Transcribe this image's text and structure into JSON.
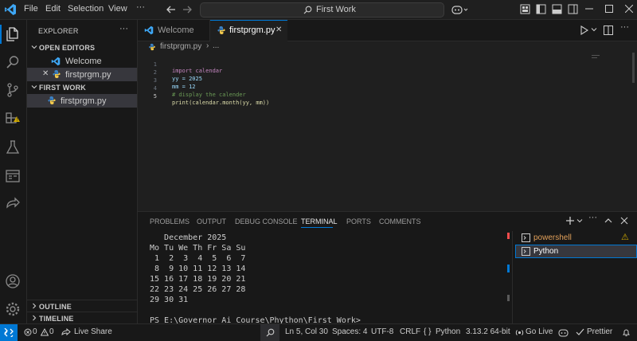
{
  "titlebar": {
    "menu": [
      "File",
      "Edit",
      "Selection",
      "View"
    ],
    "more": "···",
    "search_text": "First Work"
  },
  "sidebar": {
    "title": "EXPLORER",
    "more": "···",
    "open_editors_header": "OPEN EDITORS",
    "open_editors": [
      {
        "label": "Welcome"
      },
      {
        "label": "firstprgm.py",
        "close": "✕"
      }
    ],
    "folder_header": "FIRST WORK",
    "files": [
      {
        "label": "firstprgm.py"
      }
    ],
    "outline_header": "OUTLINE",
    "timeline_header": "TIMELINE"
  },
  "tabs": [
    {
      "label": "Welcome"
    },
    {
      "label": "firstprgm.py",
      "close": "✕"
    }
  ],
  "breadcrumb": {
    "file": "firstprgm.py",
    "sep": "›",
    "rest": "..."
  },
  "editor": {
    "line_numbers": [
      "1",
      "2",
      "3",
      "4",
      "5"
    ],
    "lines": [
      {
        "text": "import calendar",
        "color": "#c586c0"
      },
      {
        "text": "yy = 2025",
        "color": "#9cdcfe"
      },
      {
        "text": "mm = 12",
        "color": "#9cdcfe"
      },
      {
        "text": "# display the calender",
        "color": "#6a9955"
      },
      {
        "text": "print(calendar.month(yy, mm))",
        "color": "#dcdcaa"
      }
    ]
  },
  "panel": {
    "tabs": [
      "PROBLEMS",
      "OUTPUT",
      "DEBUG CONSOLE",
      "TERMINAL",
      "PORTS",
      "COMMENTS"
    ],
    "active_tab": "TERMINAL",
    "terminal_lines": [
      "   December 2025",
      "Mo Tu We Th Fr Sa Su",
      " 1  2  3  4  5  6  7",
      " 8  9 10 11 12 13 14",
      "15 16 17 18 19 20 21",
      "22 23 24 25 26 27 28",
      "29 30 31",
      "",
      "PS E:\\Governor Ai Course\\Phython\\First Work>"
    ],
    "terminals": [
      {
        "label": "powershell",
        "warning": "⚠"
      },
      {
        "label": "Python"
      }
    ]
  },
  "statusbar": {
    "errors": "0",
    "warnings": "0",
    "live_share": "Live Share",
    "position": "Ln 5, Col 30",
    "spaces": "Spaces: 4",
    "encoding": "UTF-8",
    "eol": "CRLF",
    "language": "Python",
    "interpreter": "3.13.2 64-bit",
    "go_live": "Go Live",
    "prettier": "Prettier"
  },
  "colors": {
    "accent": "#0078d4",
    "remote": "#0078d4",
    "warning": "#cca700",
    "python_icon": "#3b82c4",
    "vscode_logo": "#3ea7f5"
  },
  "icons": [
    "vscode-logo-icon",
    "back-arrow-icon",
    "forward-arrow-icon",
    "search-icon",
    "copilot-icon",
    "explorer-icon",
    "search-view-icon",
    "source-control-icon",
    "extensions-icon",
    "testing-icon",
    "remote-explorer-icon",
    "live-share-icon",
    "account-icon",
    "manage-gear-icon",
    "run-icon",
    "split-editor-icon",
    "add-terminal-icon",
    "maximize-panel-icon",
    "close-panel-icon",
    "terminal-icon",
    "bell-icon"
  ]
}
